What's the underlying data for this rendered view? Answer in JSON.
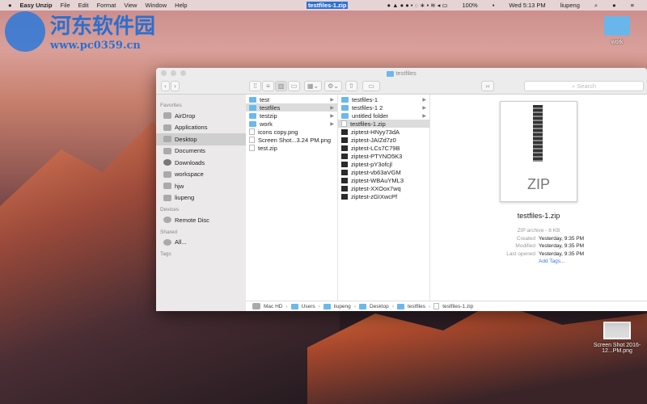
{
  "menubar": {
    "apple": "",
    "app": "Easy Unzip",
    "items": [
      "File",
      "Edit",
      "Format",
      "View",
      "Window",
      "Help"
    ],
    "selected_file": "testfiles-1.zip",
    "battery": "100%",
    "clock": "Wed 5:13 PM",
    "user": "liupeng"
  },
  "watermark": {
    "cn": "河东软件园",
    "url": "www.pc0359.cn"
  },
  "desktop": {
    "icons": [
      {
        "label": "work"
      },
      {
        "label": "Screen Shot 2016-12...PM.png"
      }
    ]
  },
  "window": {
    "title": "testfiles",
    "search_placeholder": "Search",
    "sidebar": {
      "favorites_header": "Favorites",
      "favorites": [
        "AirDrop",
        "Applications",
        "Desktop",
        "Documents",
        "Downloads",
        "workspace",
        "hjw",
        "liupeng"
      ],
      "devices_header": "Devices",
      "devices": [
        "Remote Disc"
      ],
      "shared_header": "Shared",
      "shared": [
        "All..."
      ],
      "tags_header": "Tags"
    },
    "column1": [
      {
        "name": "test",
        "type": "folder"
      },
      {
        "name": "testfiles",
        "type": "folder",
        "selected": true
      },
      {
        "name": "testzip",
        "type": "folder"
      },
      {
        "name": "work",
        "type": "folder"
      },
      {
        "name": "icons copy.png",
        "type": "image"
      },
      {
        "name": "Screen Shot...3.24 PM.png",
        "type": "image"
      },
      {
        "name": "test.zip",
        "type": "zip"
      }
    ],
    "column2": [
      {
        "name": "testfiles-1",
        "type": "folder"
      },
      {
        "name": "testfiles-1 2",
        "type": "folder"
      },
      {
        "name": "untitled folder",
        "type": "folder"
      },
      {
        "name": "testfiles-1.zip",
        "type": "zip",
        "selected": true
      },
      {
        "name": "ziptest-HNyy73dA",
        "type": "exec"
      },
      {
        "name": "ziptest-JAIZd7z0",
        "type": "exec"
      },
      {
        "name": "ziptest-LCs7C79B",
        "type": "exec"
      },
      {
        "name": "ziptest-PTYNO5K3",
        "type": "exec"
      },
      {
        "name": "ziptest-pY3ofcjl",
        "type": "exec"
      },
      {
        "name": "ziptest-vb63aVGM",
        "type": "exec"
      },
      {
        "name": "ziptest-WBAuYML3",
        "type": "exec"
      },
      {
        "name": "ziptest-XXOox7wq",
        "type": "exec"
      },
      {
        "name": "ziptest-zGIXwcPf",
        "type": "exec"
      }
    ],
    "preview": {
      "icon_label": "ZIP",
      "name": "testfiles-1.zip",
      "kind": "ZIP archive - 8 KB",
      "rows": [
        {
          "k": "Created",
          "v": "Yesterday, 9:35 PM"
        },
        {
          "k": "Modified",
          "v": "Yesterday, 9:35 PM"
        },
        {
          "k": "Last opened",
          "v": "Yesterday, 9:35 PM"
        }
      ],
      "add_tags": "Add Tags..."
    },
    "path": [
      "Mac HD",
      "Users",
      "liupeng",
      "Desktop",
      "testfiles",
      "testfiles-1.zip"
    ]
  }
}
